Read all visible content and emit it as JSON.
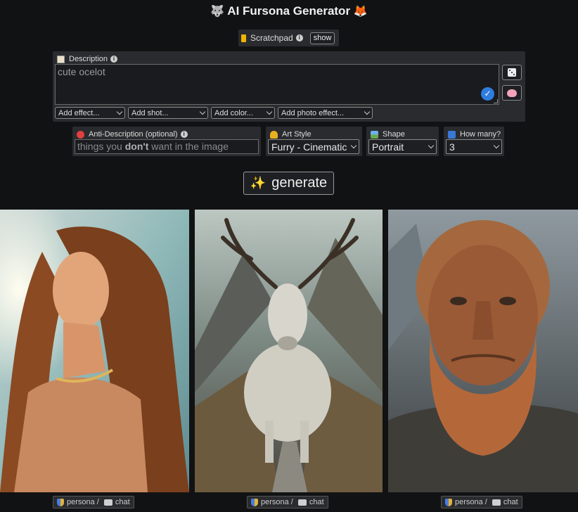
{
  "header": {
    "title": "AI Fursona Generator",
    "left_emoji": "🐺",
    "right_emoji": "🦊"
  },
  "scratchpad": {
    "label": "Scratchpad",
    "show_label": "show"
  },
  "description": {
    "label": "Description",
    "value": "cute ocelot",
    "add_menus": [
      "Add effect...",
      "Add shot...",
      "Add color...",
      "Add photo effect..."
    ]
  },
  "anti_description": {
    "label": "Anti-Description (optional)",
    "placeholder_pre": "things you ",
    "placeholder_bold": "don't",
    "placeholder_post": " want in the image"
  },
  "art_style": {
    "label": "Art Style",
    "selected": "Furry - Cinematic"
  },
  "shape": {
    "label": "Shape",
    "selected": "Portrait"
  },
  "how_many": {
    "label": "How many?",
    "selected": "3"
  },
  "generate": {
    "label": "generate",
    "icon": "sparkles-icon"
  },
  "results": [
    {
      "subject": "woman with long hair",
      "persona_label": "persona /",
      "chat_label": "chat"
    },
    {
      "subject": "white antlered creature",
      "persona_label": "persona /",
      "chat_label": "chat"
    },
    {
      "subject": "bearded man",
      "persona_label": "persona /",
      "chat_label": "chat"
    }
  ],
  "colors": {
    "background": "#111214",
    "panel": "#2a2b2e",
    "accent": "#2f7de0"
  }
}
